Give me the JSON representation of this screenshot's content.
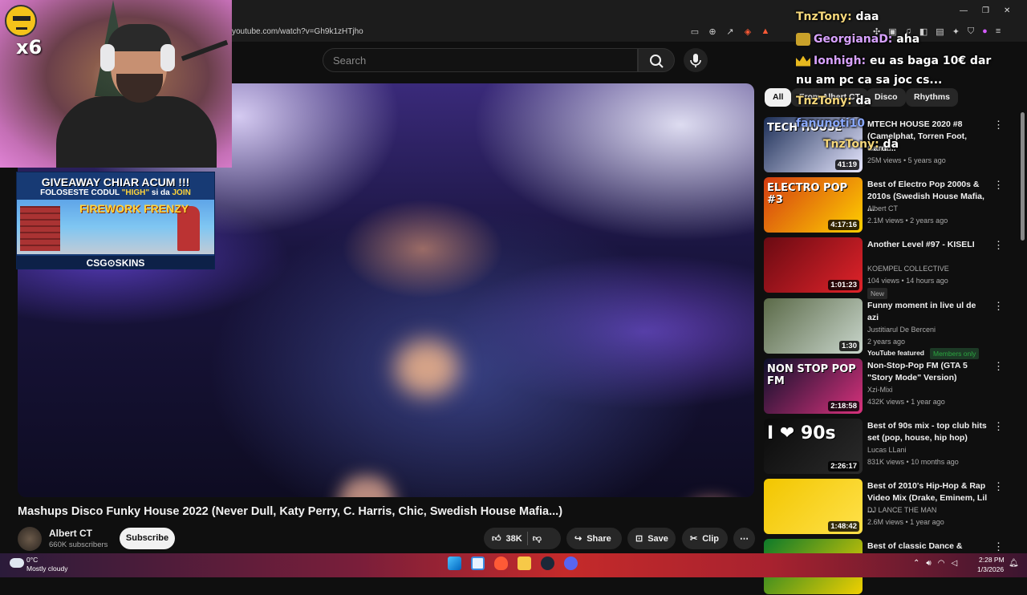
{
  "browser": {
    "url": "youtube.com/watch?v=Gh9k1zHTjho",
    "window_controls": [
      "—",
      "❐",
      "✕"
    ]
  },
  "youtube": {
    "search": {
      "placeholder": "Search"
    },
    "chips": [
      "All",
      "From Albert CT",
      "Disco",
      "Rhythms"
    ],
    "video": {
      "title": "Mashups Disco Funky House 2022 (Never Dull, Katy Perry, C. Harris, Chic, Swedish House Mafia...)",
      "channel": "Albert CT",
      "subscribers": "660K subscribers",
      "subscribe_label": "Subscribe",
      "likes": "38K",
      "share_label": "Share",
      "save_label": "Save",
      "clip_label": "Clip"
    },
    "recommended": [
      {
        "title": "MTECH HOUSE 2020 #8 (Camelphat, Torren Foot, Cardi...",
        "channel": "Santillo",
        "views": "25M views",
        "age": "5 years ago",
        "duration": "41:19",
        "thumb_text": "TECH HOUSE",
        "colors": [
          "#1c2e56",
          "#e7e7ff"
        ]
      },
      {
        "title": "Best of Electro Pop 2000s & 2010s (Swedish House Mafia, ...",
        "channel": "Albert CT",
        "views": "2.1M views",
        "age": "2 years ago",
        "duration": "4:17:16",
        "thumb_text": "ELECTRO POP #3",
        "colors": [
          "#d33b12",
          "#ffd000"
        ]
      },
      {
        "title": "Another Level #97 - KISELI",
        "channel": "KOEMPEL COLLECTIVE",
        "views": "104 views",
        "age": "14 hours ago",
        "duration": "1:01:23",
        "badge": "New",
        "colors": [
          "#6a0a12",
          "#e0232a"
        ]
      },
      {
        "title": "Funny moment in live ul de azi",
        "channel": "Justitiarul De Berceni",
        "age": "2 years ago",
        "duration": "1:30",
        "featured": "YouTube featured",
        "members": "Members only",
        "colors": [
          "#5b6a48",
          "#c9d6cc"
        ]
      },
      {
        "title": "Non-Stop-Pop FM (GTA 5 \"Story Mode\" Version)",
        "channel": "Xzi-Mixi",
        "views": "432K views",
        "age": "1 year ago",
        "duration": "2:18:58",
        "thumb_text": "NON STOP POP FM",
        "colors": [
          "#0b0f2a",
          "#d9327c"
        ]
      },
      {
        "title": "Best of 90s mix - top club hits set (pop, house, hip hop)",
        "channel": "Lucas LLani",
        "views": "831K views",
        "age": "10 months ago",
        "duration": "2:26:17",
        "thumb_text": "I ❤ 90s",
        "colors": [
          "#0a0a0a",
          "#2b2b2b"
        ]
      },
      {
        "title": "Best of 2010's Hip-Hop & Rap Video Mix (Drake, Eminem, Lil ...",
        "channel": "DJ LANCE THE MAN",
        "views": "2.6M views",
        "age": "1 year ago",
        "duration": "1:48:42",
        "colors": [
          "#f2c600",
          "#ffe14a"
        ]
      },
      {
        "title": "Best of classic Dance & House",
        "colors": [
          "#0c7a2a",
          "#f0d000"
        ]
      }
    ]
  },
  "stream_overlay": {
    "multiplier": "x6",
    "giveaway": {
      "title": "GIVEAWAY CHIAR ACUM !!!",
      "sub_prefix": "FOLOSESTE CODUL ",
      "code": "\"HIGH\"",
      "sub_mid": " si da ",
      "join": "JOIN",
      "game": "FIREWORK FRENZY",
      "brand": "CSG⊙SKINS"
    },
    "chat": [
      {
        "user": "TnzTony:",
        "message": "daa"
      },
      {
        "user": "GeorgianaD:",
        "message": "aha"
      },
      {
        "user": "Ionhigh:",
        "message": "eu as baga 10€ dar"
      },
      {
        "user": "",
        "message": "nu am pc ca sa joc cs..."
      },
      {
        "user": "TnzTony:",
        "message": "da"
      },
      {
        "user": "fanunoti10",
        "message": ""
      },
      {
        "user": "TnzTony:",
        "message": "da"
      }
    ]
  },
  "taskbar": {
    "temperature": "0°C",
    "weather": "Mostly cloudy",
    "time": "2:28 PM",
    "date": "1/3/2026"
  }
}
